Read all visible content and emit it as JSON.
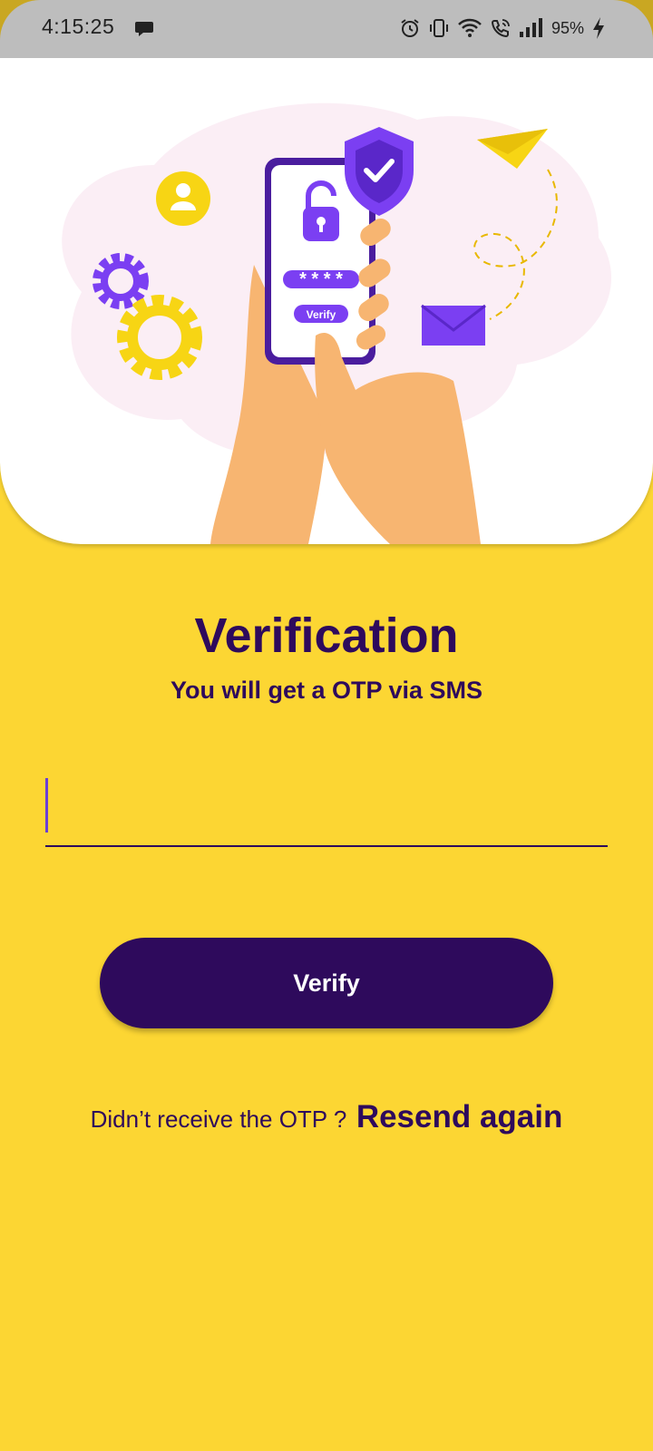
{
  "status_bar": {
    "time": "4:15:25",
    "battery": "95%",
    "icons": [
      "message-icon",
      "alarm-icon",
      "vibrate-icon",
      "wifi-icon",
      "wifi-call-icon",
      "signal-icon",
      "charging-icon"
    ]
  },
  "illustration": {
    "pin_mask": "* * * *",
    "phone_button_label": "Verify"
  },
  "verification": {
    "title": "Verification",
    "subtitle": "You will get a OTP via SMS"
  },
  "otp_input": {
    "value": "",
    "placeholder": ""
  },
  "verify_button": {
    "label": "Verify"
  },
  "resend": {
    "prompt": "Didn’t receive the OTP ?",
    "link_label": "Resend again"
  },
  "colors": {
    "background": "#FCD633",
    "primary": "#2E0A5C",
    "accent_purple": "#7B3FF2",
    "status_bar": "#BDBDBD"
  }
}
